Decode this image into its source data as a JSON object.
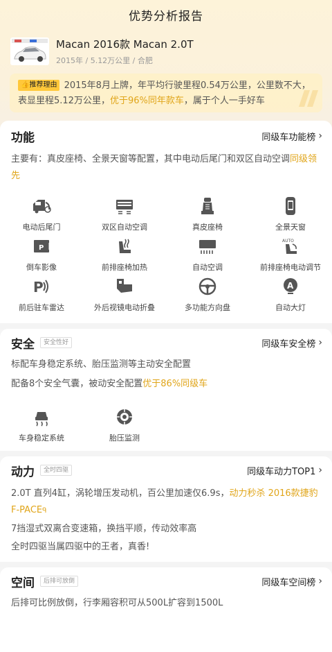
{
  "header": {
    "title": "优势分析报告"
  },
  "car": {
    "name": "Macan 2016款 Macan 2.0T",
    "meta": "2015年 / 5.12万公里 / 合肥"
  },
  "reason": {
    "badge": "推荐理由",
    "text_a": "2015年8月上牌，年平均行驶里程0.54万公里，公里数不大，表显里程5.12万公里，",
    "highlight": "优于96%同年款车",
    "text_b": "，属于个人一手好车"
  },
  "function": {
    "title": "功能",
    "link": "同级车功能榜",
    "desc_a": "主要有：真皮座椅、全景天窗等配置，其中电动后尾门和双区自动空调",
    "desc_hl": "同级领先",
    "features": [
      {
        "label": "电动后尾门",
        "icon": "power-tailgate-icon"
      },
      {
        "label": "双区自动空调",
        "icon": "dual-zone-ac-icon"
      },
      {
        "label": "真皮座椅",
        "icon": "leather-seat-icon"
      },
      {
        "label": "全景天窗",
        "icon": "panoramic-sunroof-icon"
      },
      {
        "label": "倒车影像",
        "icon": "reverse-camera-icon"
      },
      {
        "label": "前排座椅加热",
        "icon": "seat-heating-icon"
      },
      {
        "label": "自动空调",
        "icon": "auto-ac-icon"
      },
      {
        "label": "前排座椅电动调节",
        "icon": "power-seat-icon"
      },
      {
        "label": "前后驻车雷达",
        "icon": "parking-radar-icon"
      },
      {
        "label": "外后视镜电动折叠",
        "icon": "mirror-fold-icon"
      },
      {
        "label": "多功能方向盘",
        "icon": "steering-wheel-icon"
      },
      {
        "label": "自动大灯",
        "icon": "auto-headlight-icon"
      }
    ]
  },
  "safety": {
    "title": "安全",
    "tag": "安全性好",
    "link": "同级车安全榜",
    "line1": "标配车身稳定系统、胎压监测等主动安全配置",
    "line2_a": "配备8个安全气囊，被动安全配置",
    "line2_hl": "优于86%同级车",
    "features": [
      {
        "label": "车身稳定系统",
        "icon": "stability-control-icon"
      },
      {
        "label": "胎压监测",
        "icon": "tire-pressure-icon"
      }
    ]
  },
  "power": {
    "title": "动力",
    "tag": "全时四驱",
    "link": "同级车动力TOP1",
    "line1_a": "2.0T 直列4缸，涡轮增压发动机，百公里加速仅6.9s，",
    "line1_hl": "动力秒杀 2016款捷豹F-PACE",
    "line2": "7挡湿式双离合变速箱，换挡平顺，传动效率高",
    "line3": "全时四驱当属四驱中的王者，真香!"
  },
  "space": {
    "title": "空间",
    "tag": "后排可放倒",
    "link": "同级车空间榜",
    "line1": "后排可比例放倒，行李厢容积可从500L扩容到1500L"
  },
  "colors": {
    "accent": "#e0a51a",
    "badge": "#ffc83a"
  }
}
